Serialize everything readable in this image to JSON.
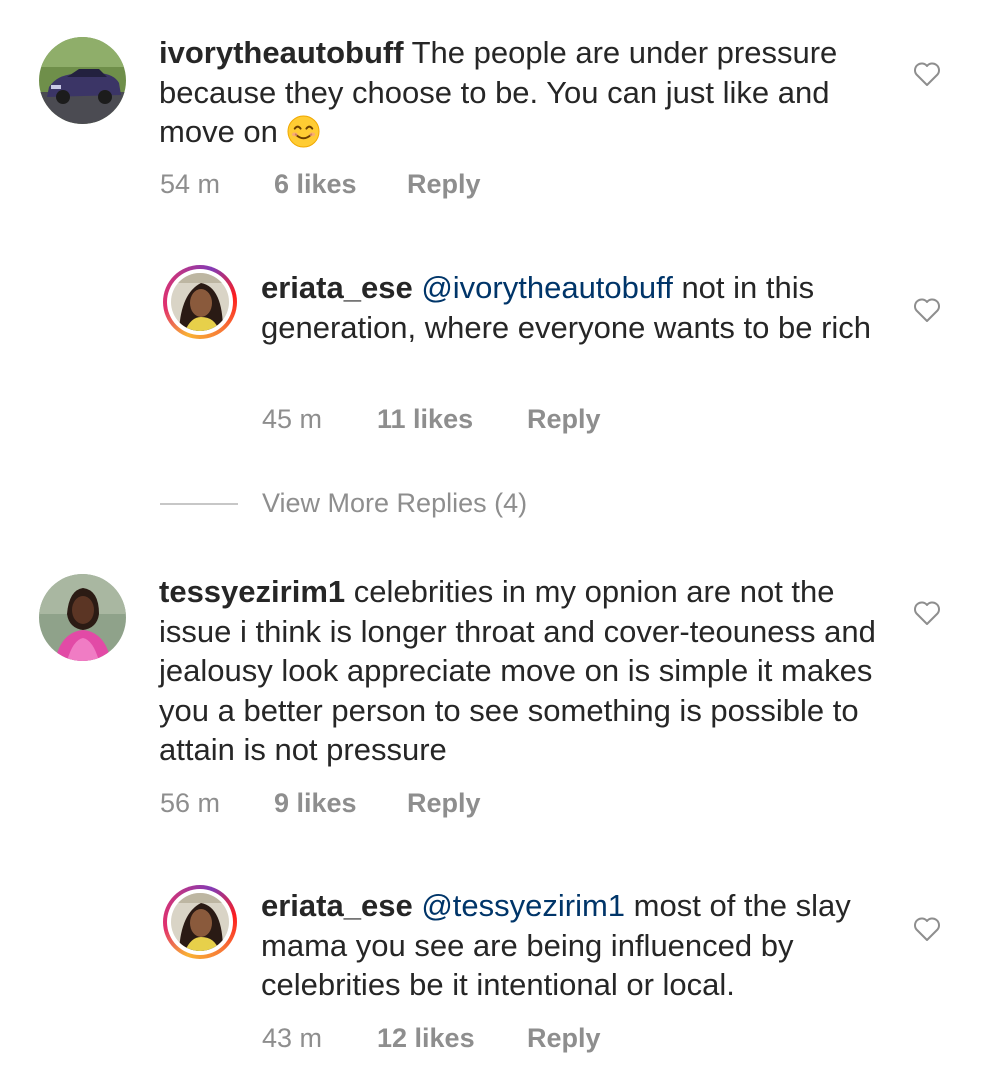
{
  "comments": [
    {
      "username": "ivorytheautobuff",
      "mention": "",
      "text": "The people are under pressure because they choose to be. You can just like and move on",
      "emoji": "smiling-face-emoji",
      "time": "54 m",
      "likes": "6 likes",
      "reply": "Reply",
      "is_reply": false
    },
    {
      "username": "eriata_ese",
      "mention": "@ivorytheautobuff",
      "text": "not in this generation, where everyone wants to be rich",
      "time": "45 m",
      "likes": "11 likes",
      "reply": "Reply",
      "is_reply": true
    },
    {
      "username": "tessyezirim1",
      "mention": "",
      "text": "celebrities in my opnion are not the issue i think is longer throat and cover-teouness and jealousy look appreciate move on is simple it makes you a better person to see something is possible to attain is not pressure",
      "time": "56 m",
      "likes": "9 likes",
      "reply": "Reply",
      "is_reply": false
    },
    {
      "username": "eriata_ese",
      "mention": "@tessyezirim1",
      "text": "most of the slay mama you see are being influenced by celebrities be it intentional or local.",
      "time": "43 m",
      "likes": "12 likes",
      "reply": "Reply",
      "is_reply": true
    }
  ],
  "view_more_replies": "View More Replies (4)",
  "icons": {
    "like": "heart-outline-icon",
    "story_ring": "story-ring-gradient"
  },
  "colors": {
    "text": "#262626",
    "meta": "#8e8e8e",
    "mention": "#003569",
    "divider": "#c7c7c7"
  }
}
